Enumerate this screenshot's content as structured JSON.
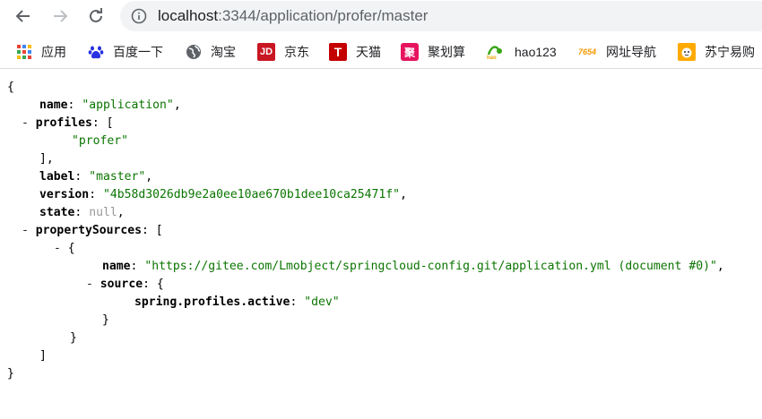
{
  "browser": {
    "url_host": "localhost",
    "url_path": ":3344/application/profer/master"
  },
  "bookmarks": [
    {
      "label": "应用",
      "icon": "apps-grid-icon"
    },
    {
      "label": "百度一下",
      "icon": "baidu-paw-icon"
    },
    {
      "label": "淘宝",
      "icon": "globe-icon"
    },
    {
      "label": "京东",
      "icon": "jd-icon"
    },
    {
      "label": "天猫",
      "icon": "tmall-icon"
    },
    {
      "label": "聚划算",
      "icon": "juhuasuan-icon"
    },
    {
      "label": "hao123",
      "icon": "hao123-icon"
    },
    {
      "label": "网址导航",
      "icon": "7654-icon"
    },
    {
      "label": "苏宁易购",
      "icon": "suning-icon"
    }
  ],
  "json": {
    "open_brace": "{",
    "close_brace": "}",
    "name_key": "name",
    "name_value": "\"application\"",
    "profiles_key": "profiles",
    "profiles_items": [
      "\"profer\""
    ],
    "label_key": "label",
    "label_value": "\"master\"",
    "version_key": "version",
    "version_value": "\"4b58d3026db9e2a0ee10ae670b1dee10ca25471f\"",
    "state_key": "state",
    "state_value": "null",
    "propertySources_key": "propertySources",
    "ps_name_key": "name",
    "ps_name_value": "\"https://gitee.com/Lmobject/springcloud-config.git/application.yml (document #0)\"",
    "source_key": "source",
    "source_prop_key": "spring.profiles.active",
    "source_prop_value": "\"dev\"",
    "toggle": "-"
  }
}
